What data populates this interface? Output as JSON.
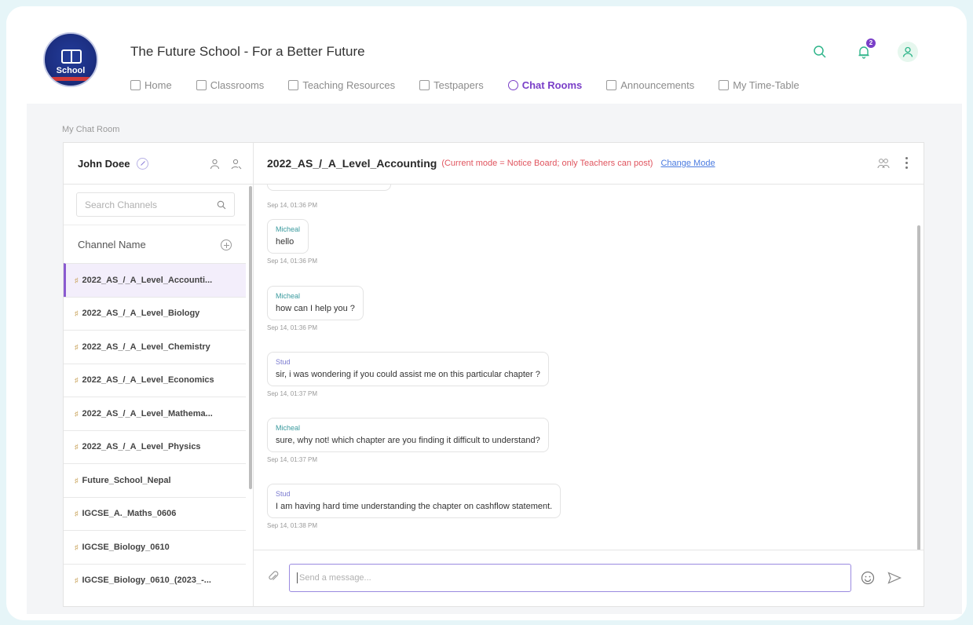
{
  "app": {
    "logo_text": "School",
    "title": "The Future School - For a Better Future"
  },
  "nav": [
    {
      "label": "Home",
      "icon": "home-grid-icon",
      "active": false
    },
    {
      "label": "Classrooms",
      "icon": "classroom-board-icon",
      "active": false
    },
    {
      "label": "Teaching Resources",
      "icon": "book-icon",
      "active": false
    },
    {
      "label": "Testpapers",
      "icon": "document-icon",
      "active": false
    },
    {
      "label": "Chat Rooms",
      "icon": "chat-bubble-icon",
      "active": true
    },
    {
      "label": "Announcements",
      "icon": "megaphone-icon",
      "active": false
    },
    {
      "label": "My Time-Table",
      "icon": "calendar-icon",
      "active": false
    }
  ],
  "header_icons": {
    "search": "search-icon",
    "notifications": "bell-icon",
    "notification_count": "2",
    "profile": "user-icon"
  },
  "section_label": "My Chat Room",
  "sidebar": {
    "user_name": "John Doee",
    "search_placeholder": "Search Channels",
    "channel_header": "Channel Name",
    "channels": [
      {
        "name": "2022_AS_/_A_Level_Accounti...",
        "active": true
      },
      {
        "name": "2022_AS_/_A_Level_Biology",
        "active": false
      },
      {
        "name": "2022_AS_/_A_Level_Chemistry",
        "active": false
      },
      {
        "name": "2022_AS_/_A_Level_Economics",
        "active": false
      },
      {
        "name": "2022_AS_/_A_Level_Mathema...",
        "active": false
      },
      {
        "name": "2022_AS_/_A_Level_Physics",
        "active": false
      },
      {
        "name": "Future_School_Nepal",
        "active": false
      },
      {
        "name": "IGCSE_A._Maths_0606",
        "active": false
      },
      {
        "name": "IGCSE_Biology_0610",
        "active": false
      },
      {
        "name": "IGCSE_Biology_0610_(2023_-...",
        "active": false
      }
    ]
  },
  "chat": {
    "channel_title": "2022_AS_/_A_Level_Accounting",
    "mode_note": "(Current mode = Notice Board; only Teachers can post)",
    "change_mode_label": "Change Mode",
    "messages": [
      {
        "time": "Sep 14, 01:36 PM"
      },
      {
        "sender": "Micheal",
        "role": "teacher",
        "text": "hello",
        "time": "Sep 14, 01:36 PM"
      },
      {
        "sender": "Micheal",
        "role": "teacher",
        "text": "how can I help you ?",
        "time": "Sep 14, 01:36 PM"
      },
      {
        "sender": "Stud",
        "role": "student",
        "text": "sir, i was wondering if you could assist me on this particular chapter ?",
        "time": "Sep 14, 01:37 PM"
      },
      {
        "sender": "Micheal",
        "role": "teacher",
        "text": "sure, why not! which chapter are you finding it difficult to understand?",
        "time": "Sep 14, 01:37 PM"
      },
      {
        "sender": "Stud",
        "role": "student",
        "text": "I am having hard time understanding the chapter on cashflow statement.",
        "time": "Sep 14, 01:38 PM"
      }
    ],
    "input_placeholder": "Send a message..."
  }
}
